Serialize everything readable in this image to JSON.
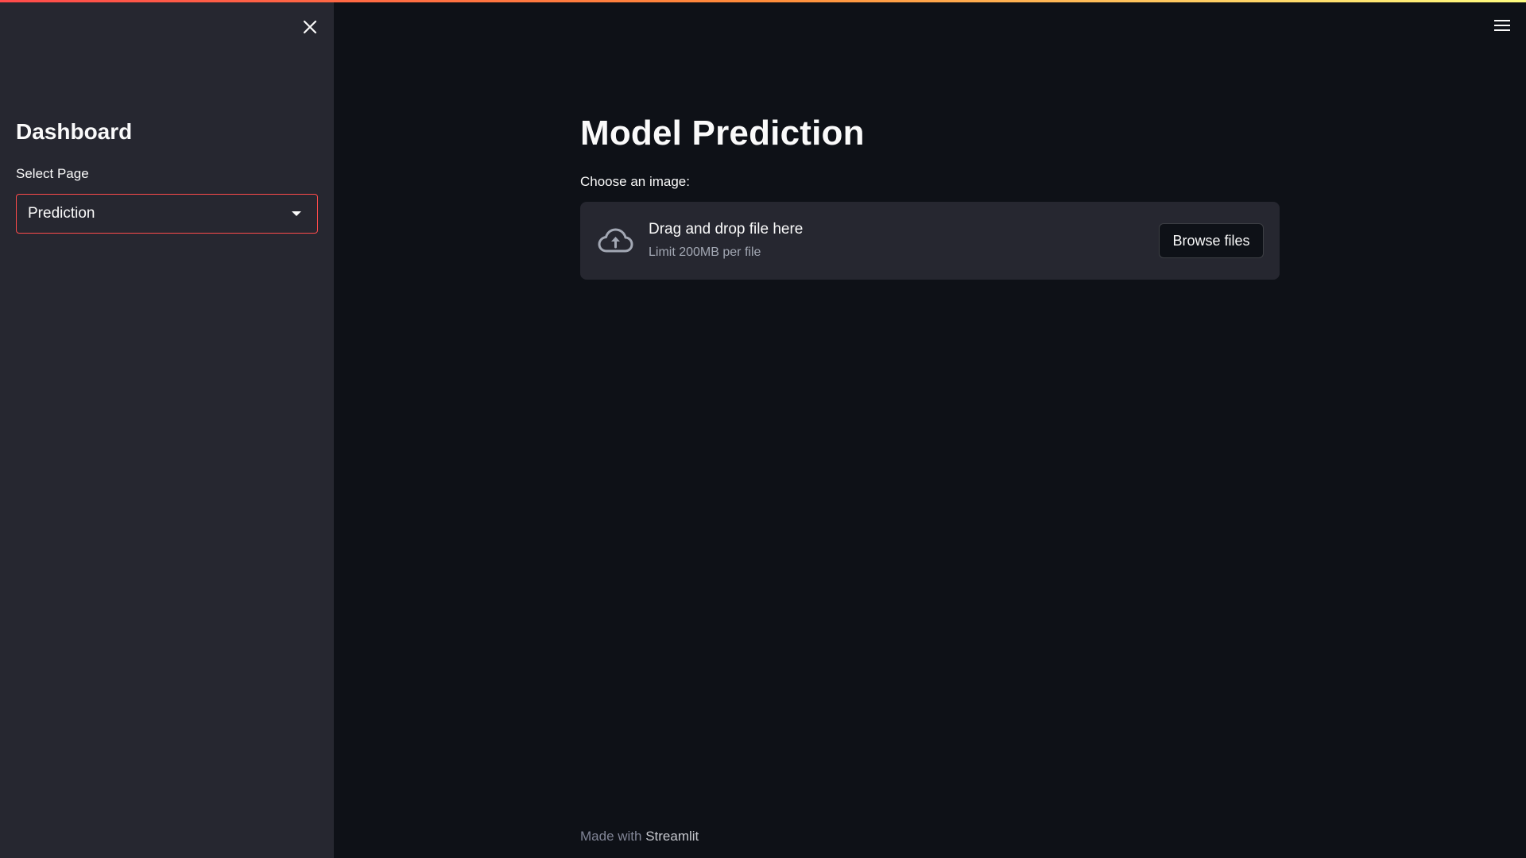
{
  "colors": {
    "background": "#0e1117",
    "sidebar_background": "#262730",
    "accent": "#ff4b4b",
    "text": "#fafafa",
    "muted_text": "#a3a8b4"
  },
  "sidebar": {
    "close_icon": "close-icon",
    "title": "Dashboard",
    "select_label": "Select Page",
    "select_value": "Prediction",
    "select_icon": "chevron-down-icon"
  },
  "header": {
    "menu_icon": "hamburger-menu-icon"
  },
  "main": {
    "title": "Model Prediction",
    "uploader": {
      "label": "Choose an image:",
      "icon": "cloud-upload-icon",
      "instructions": "Drag and drop file here",
      "limit": "Limit 200MB per file",
      "browse_label": "Browse files"
    }
  },
  "footer": {
    "prefix": "Made with ",
    "link": "Streamlit"
  }
}
